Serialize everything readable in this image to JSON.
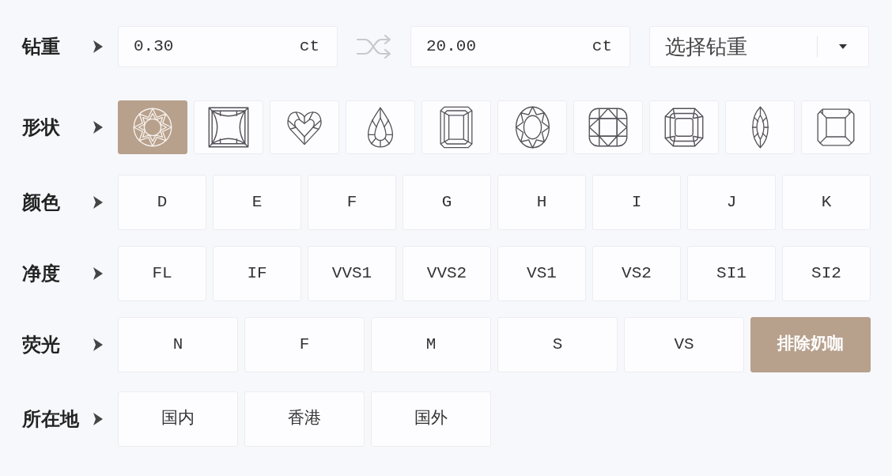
{
  "carat": {
    "label": "钻重",
    "min": {
      "value": "0.30",
      "unit": "ct"
    },
    "max": {
      "value": "20.00",
      "unit": "ct"
    },
    "select": {
      "placeholder": "选择钻重"
    }
  },
  "shape": {
    "label": "形状",
    "options": [
      {
        "kind": "round",
        "selected": true
      },
      {
        "kind": "princess",
        "selected": false
      },
      {
        "kind": "heart",
        "selected": false
      },
      {
        "kind": "pear",
        "selected": false
      },
      {
        "kind": "emerald",
        "selected": false
      },
      {
        "kind": "oval",
        "selected": false
      },
      {
        "kind": "cushion",
        "selected": false
      },
      {
        "kind": "radiant",
        "selected": false
      },
      {
        "kind": "marquise",
        "selected": false
      },
      {
        "kind": "asscher",
        "selected": false
      }
    ]
  },
  "color": {
    "label": "颜色",
    "options": [
      {
        "label": "D",
        "selected": false
      },
      {
        "label": "E",
        "selected": false
      },
      {
        "label": "F",
        "selected": false
      },
      {
        "label": "G",
        "selected": false
      },
      {
        "label": "H",
        "selected": false
      },
      {
        "label": "I",
        "selected": false
      },
      {
        "label": "J",
        "selected": false
      },
      {
        "label": "K",
        "selected": false
      }
    ]
  },
  "clarity": {
    "label": "净度",
    "options": [
      {
        "label": "FL",
        "selected": false
      },
      {
        "label": "IF",
        "selected": false
      },
      {
        "label": "VVS1",
        "selected": false
      },
      {
        "label": "VVS2",
        "selected": false
      },
      {
        "label": "VS1",
        "selected": false
      },
      {
        "label": "VS2",
        "selected": false
      },
      {
        "label": "SI1",
        "selected": false
      },
      {
        "label": "SI2",
        "selected": false
      }
    ]
  },
  "fluorescence": {
    "label": "荧光",
    "options": [
      {
        "label": "N",
        "selected": false
      },
      {
        "label": "F",
        "selected": false
      },
      {
        "label": "M",
        "selected": false
      },
      {
        "label": "S",
        "selected": false
      },
      {
        "label": "VS",
        "selected": false
      },
      {
        "label": "排除奶咖",
        "selected": true
      }
    ]
  },
  "location": {
    "label": "所在地",
    "options": [
      {
        "label": "国内",
        "selected": false
      },
      {
        "label": "香港",
        "selected": false
      },
      {
        "label": "国外",
        "selected": false
      }
    ]
  }
}
